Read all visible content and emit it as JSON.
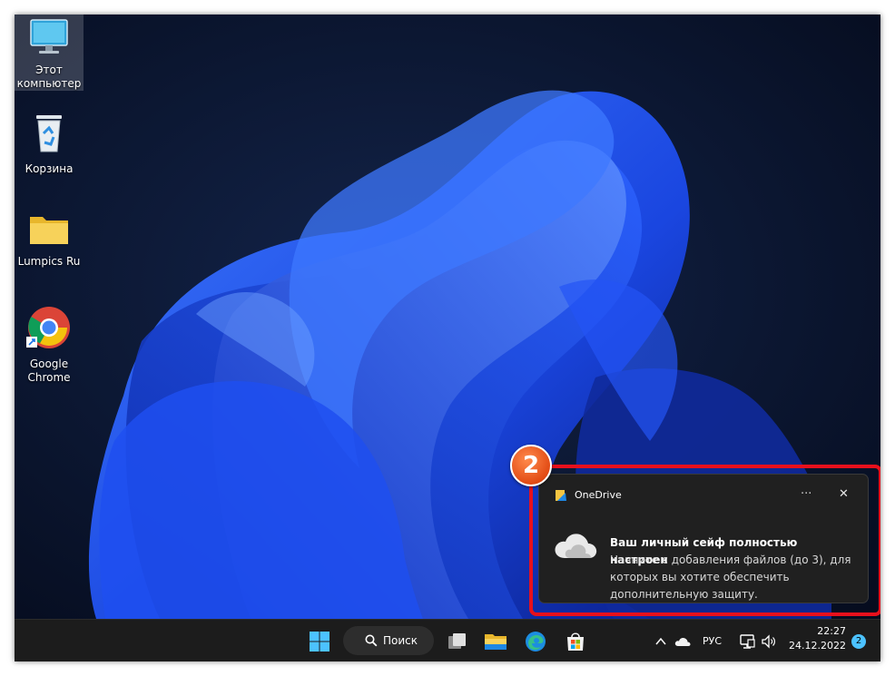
{
  "desktop": {
    "icons": [
      {
        "label": "Этот компьютер"
      },
      {
        "label": "Корзина"
      },
      {
        "label": "Lumpics Ru"
      },
      {
        "label": "Google Chrome"
      }
    ]
  },
  "notification": {
    "app_name": "OneDrive",
    "more_label": "···",
    "close_label": "✕",
    "title": "Ваш личный сейф полностью настроен",
    "body": "Начните с добавления файлов (до 3), для которых вы хотите обеспечить дополнительную защиту.",
    "step_number": "2"
  },
  "taskbar": {
    "search_label": "Поиск",
    "language": "РУС",
    "time": "22:27",
    "date": "24.12.2022",
    "notification_count": "2",
    "pinned": [
      "start-icon",
      "search-icon",
      "task-view-icon",
      "file-explorer-icon",
      "edge-icon",
      "store-icon"
    ],
    "tray_icons": [
      "chevron-up-icon",
      "onedrive-cloud-icon",
      "network-icon",
      "volume-icon"
    ]
  },
  "colors": {
    "highlight": "#e8101c",
    "step_badge": "#e24b14",
    "taskbar": "#1c1c1c",
    "toast": "#202020"
  }
}
